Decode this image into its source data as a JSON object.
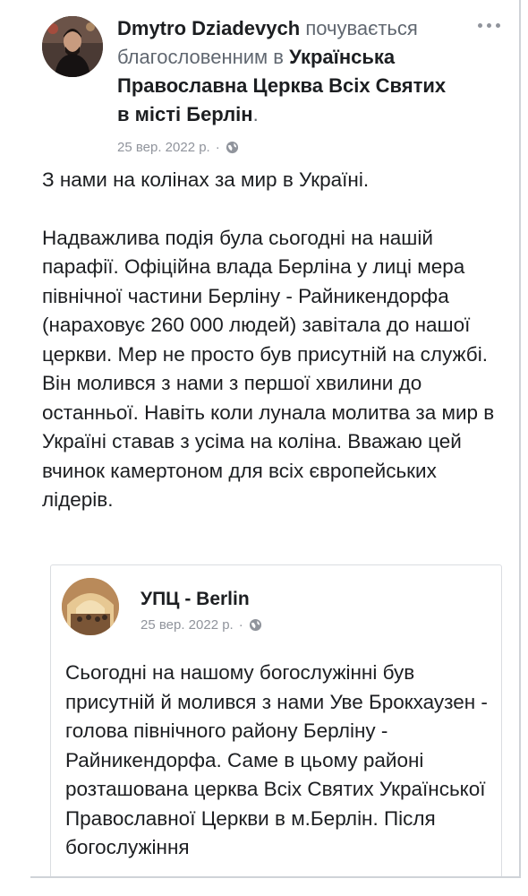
{
  "post": {
    "author": "Dmytro Dziadevych",
    "feeling_text": "почувається благословенним в",
    "page_name": "Українська Православна Церква Всіх Святих в місті Берлін",
    "page_suffix": ".",
    "date": "25 вер. 2022 р.",
    "separator": "·",
    "privacy_icon": "globe-icon",
    "more_icon": "more-options-icon",
    "paragraph_1": "З нами на колінах за мир в Україні.",
    "paragraph_2": "Надважлива подія була сьогодні на нашій парафії. Офіційна влада Берліна у лиці мера північної частини Берліну - Райникендорфа (нараховує 260 000 людей) завітала до нашої церкви. Мер не просто був присутній на службі. Він молився з нами з першої хвилини до останньої. Навіть коли лунала молитва за мир в Україні ставав з усіма на коліна. Вважаю цей вчинок камертоном для всіх європейських лідерів."
  },
  "shared": {
    "name": "УПЦ - Berlin",
    "date": "25 вер. 2022 р.",
    "separator": "·",
    "privacy_icon": "globe-icon",
    "text": "Сьогодні на нашому богослужінні був присутній й молився з нами Уве Брокхаузен - голова північного району Берліну - Райникендорфа. Саме в цьому районі розташована церква Всіх Святих Української Православної Церкви в м.Берлін. Після богослужіння"
  },
  "colors": {
    "text": "#1c1e21",
    "secondary": "#606770",
    "meta": "#90949c",
    "border": "#dadde1"
  }
}
